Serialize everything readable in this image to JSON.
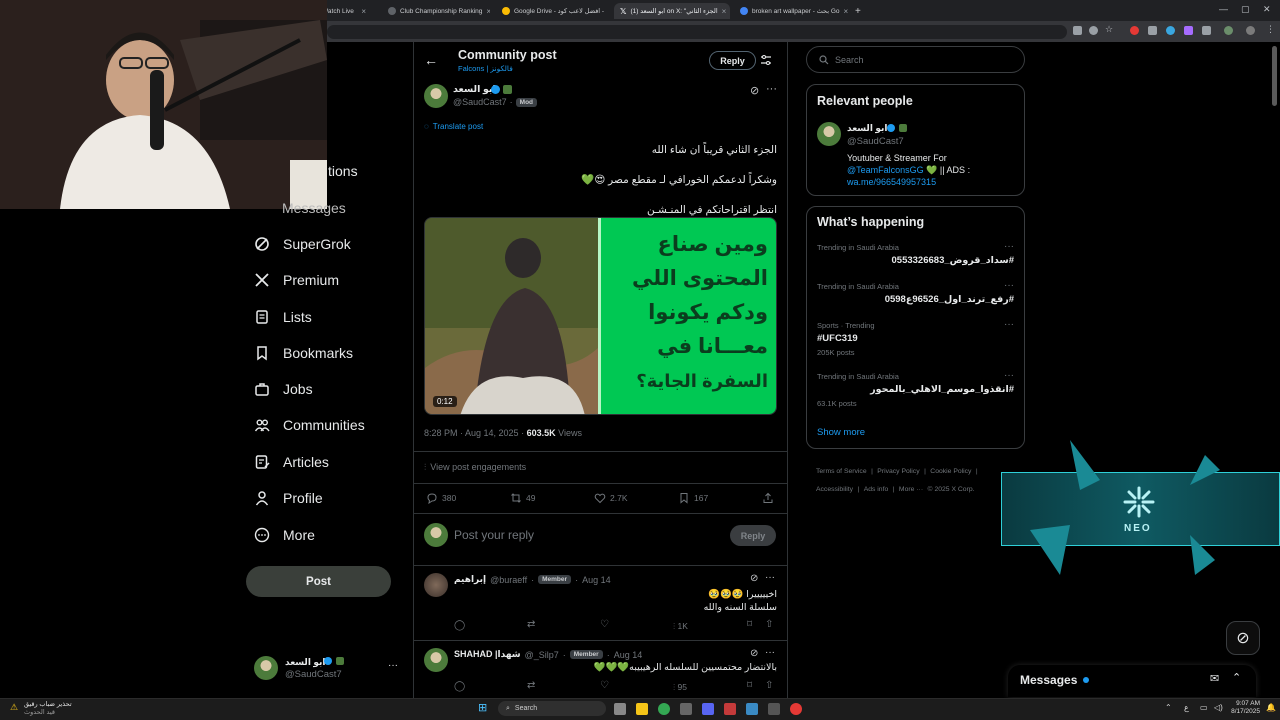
{
  "browser": {
    "tabs": [
      {
        "label": "Watch Live"
      },
      {
        "label": "Club Championship Ranking"
      },
      {
        "label": "Google Drive - افضل لاعب كود -"
      },
      {
        "label": "(1) ابو السعد on X: \"الجزء الثاني"
      },
      {
        "label": "broken art wallpaper - بحث Go"
      }
    ],
    "new_tab": "+",
    "close": "×"
  },
  "sidebar": {
    "items": [
      {
        "label": "Notifications",
        "visible_label": "tions"
      },
      {
        "label": "Messages"
      },
      {
        "label": "SuperGrok"
      },
      {
        "label": "Premium"
      },
      {
        "label": "Lists"
      },
      {
        "label": "Bookmarks"
      },
      {
        "label": "Jobs"
      },
      {
        "label": "Communities"
      },
      {
        "label": "Articles"
      },
      {
        "label": "Profile"
      },
      {
        "label": "More"
      }
    ],
    "post_label": "Post",
    "account": {
      "name": "ابو السعد",
      "handle": "@SaudCast7",
      "more": "···"
    }
  },
  "header": {
    "title": "Community post",
    "subtitle": "Falcons | فالكونز",
    "reply_label": "Reply"
  },
  "post": {
    "author_name": "ابو السعد",
    "handle": "@SaudCast7",
    "separator": "·",
    "role": "Mod",
    "translate": "Translate post",
    "lines": [
      "الجزء الثاني قريباً ان شاء الله",
      "وشكراً لدعمكم الخورافي لـ مقطع مصر 😍💚",
      "انتظر اقتراحاتكم في المنـشـن"
    ],
    "video": {
      "duration": "0:12",
      "overlay_lines": [
        "ومين صناع",
        "المحتوى اللي",
        "ودكم يكونوا",
        "معـــانا في",
        "السفرة الجاية؟"
      ]
    },
    "time": "8:28 PM · Aug 14, 2025 · ",
    "views_count": "603.5K",
    "views_label": " Views",
    "engagements": "View post engagements",
    "stats": {
      "replies": "380",
      "reposts": "49",
      "likes": "2.7K",
      "bookmarks": "167"
    }
  },
  "reply_box": {
    "placeholder": "Post your reply",
    "button": "Reply"
  },
  "replies": [
    {
      "name": "إبراهيم",
      "handle": "@buraeff",
      "separator": "·",
      "role": "Member",
      "date": "Aug 14",
      "lines": [
        "اخيييييرا 🥹🥹🥹",
        "سلسلة السنه والله"
      ],
      "views": "1K"
    },
    {
      "name": "SHAHAD |شهدا",
      "handle": "@_Silp7",
      "separator": "·",
      "role": "Member",
      "date": "Aug 14",
      "lines": [
        "بالانتضار محتمسيين للسلسله الرهيبيبه💚💚💚"
      ],
      "views": "95"
    }
  ],
  "right": {
    "search_placeholder": "Search",
    "relevant": {
      "title": "Relevant people",
      "name": "ابو السعد",
      "handle": "@SaudCast7",
      "bio_1": "Youtuber & Streamer For",
      "bio_link": "@TeamFalconsGG",
      "bio_2": " 💚 || ADS :",
      "bio_url": "wa.me/966549957315"
    },
    "happening": {
      "title": "What’s happening",
      "trends": [
        {
          "category": "Trending in Saudi Arabia",
          "name": "#سداد_قروض_0553326683",
          "count": ""
        },
        {
          "category": "Trending in Saudi Arabia",
          "name": "#رفع_ترند_اول_96526ع0598",
          "count": ""
        },
        {
          "category": "Sports · Trending",
          "name": "#UFC319",
          "count": "205K posts"
        },
        {
          "category": "Trending in Saudi Arabia",
          "name": "#انقذوا_موسم_الاهلي_بالمحور",
          "count": "63.1K posts"
        }
      ],
      "more": "···",
      "show_more": "Show more"
    },
    "footer": [
      "Terms of Service",
      "|",
      "Privacy Policy",
      "|",
      "Cookie Policy",
      "|",
      "Accessibility",
      "|",
      "Ads info",
      "|",
      "More ···",
      "© 2025 X Corp."
    ]
  },
  "neo_overlay": {
    "text": "NEO"
  },
  "messages_bar": {
    "label": "Messages"
  },
  "taskbar": {
    "weather_line1": "تحذير ضباب رقيق",
    "weather_line2": "قيد الحدوث",
    "search": "Search",
    "time": "9:07 AM",
    "date": "8/17/2025",
    "lang": "ع"
  },
  "colors": {
    "accent": "#1d9bf0",
    "green": "#00c853",
    "verified": "#1d9bf0"
  }
}
